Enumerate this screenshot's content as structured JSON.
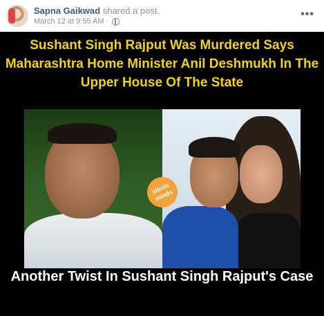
{
  "post": {
    "author": "Sapna Gaikwad",
    "action": "shared a post.",
    "timestamp": "March 12 at 9:55 AM",
    "separator": "·",
    "privacy_icon": "globe-icon",
    "more_icon": "more-options-icon",
    "more_label": "•••"
  },
  "image": {
    "headline": "Sushant Singh Rajput Was Murdered Says Maharashtra Home Minister Anil Deshmukh In The Upper House Of The State",
    "bottom_caption": "Another Twist In Sushant Singh Rajput's Case",
    "logo_text": "idiotic minds"
  },
  "colors": {
    "author": "#385898",
    "meta": "#90949c",
    "headline": "#f0d02a",
    "image_bg": "#000000",
    "caption": "#ffffff"
  }
}
